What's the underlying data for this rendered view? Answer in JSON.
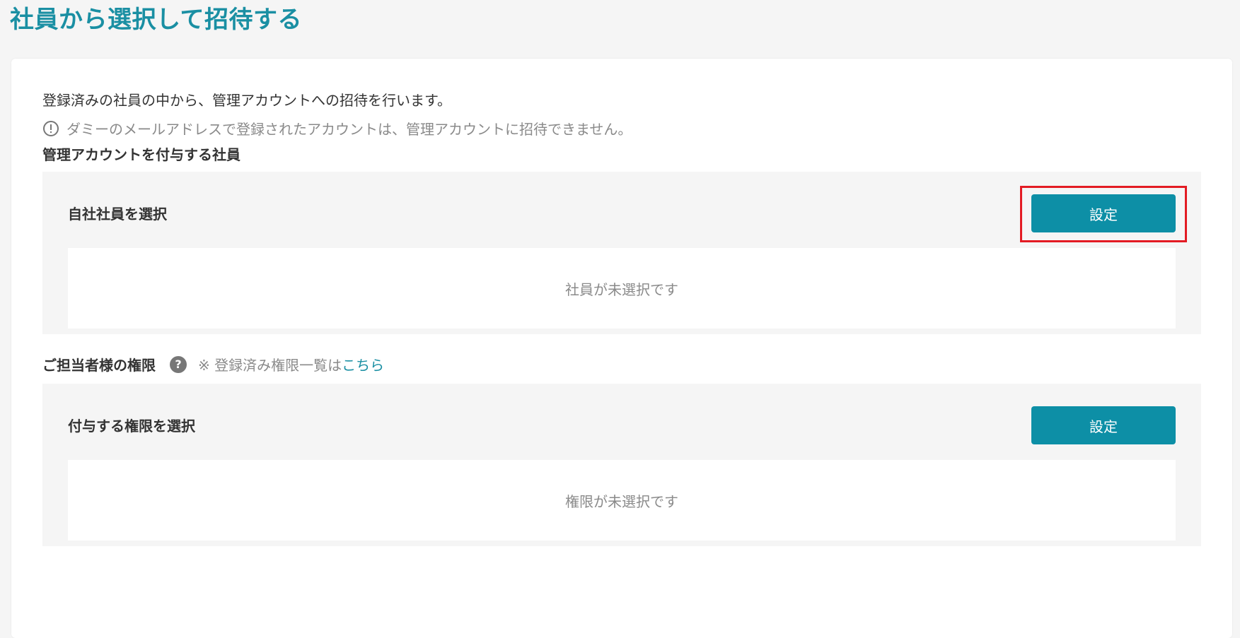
{
  "page": {
    "title": "社員から選択して招待する"
  },
  "intro": {
    "text": "登録済みの社員の中から、管理アカウントへの招待を行います。",
    "notice": "ダミーのメールアドレスで登録されたアカウントは、管理アカウントに招待できません。"
  },
  "employee_section": {
    "label": "管理アカウントを付与する社員",
    "panel_title": "自社社員を選択",
    "button_label": "設定",
    "empty_text": "社員が未選択です"
  },
  "permission_section": {
    "label": "ご担当者様の権限",
    "note_prefix": "※ 登録済み権限一覧は",
    "link_text": "こちら",
    "panel_title": "付与する権限を選択",
    "button_label": "設定",
    "empty_text": "権限が未選択です"
  },
  "icons": {
    "notice": "exclamation-circle-icon",
    "help": "question-circle-icon"
  },
  "colors": {
    "accent": "#1a8fa3",
    "button": "#0d8fa6",
    "highlight": "#e31b23"
  }
}
